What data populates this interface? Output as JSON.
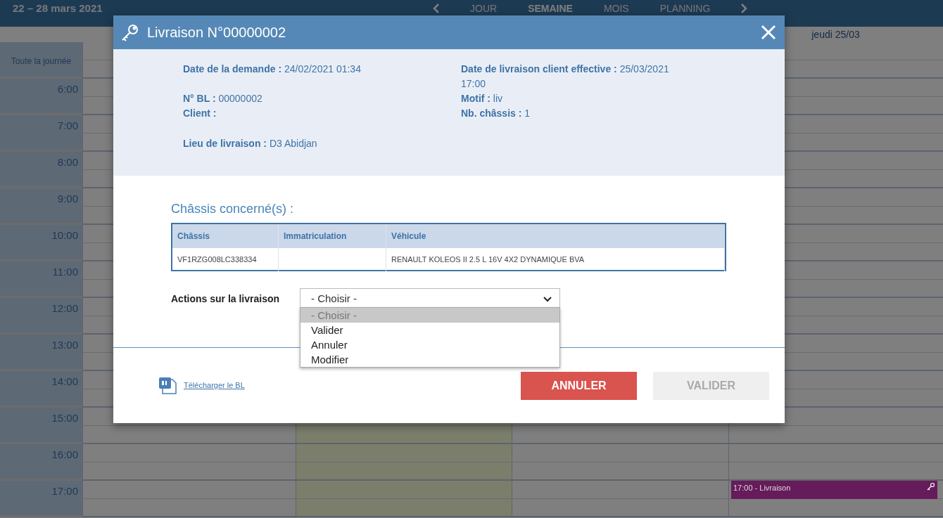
{
  "calendar": {
    "range": "22 – 28 mars 2021",
    "views": [
      {
        "label": "JOUR",
        "selected": false
      },
      {
        "label": "SEMAINE",
        "selected": true
      },
      {
        "label": "MOIS",
        "selected": false
      },
      {
        "label": "PLANNING",
        "selected": false
      }
    ],
    "day_header": "jeudi 25/03",
    "all_day_label": "Toute la journée",
    "hours": [
      "6:00",
      "7:00",
      "8:00",
      "9:00",
      "10:00",
      "11:00",
      "12:00",
      "13:00",
      "14:00",
      "15:00",
      "16:00",
      "17:00"
    ],
    "events": [
      {
        "label": "17:00 - Livraison",
        "color": "#661b5a"
      }
    ]
  },
  "modal": {
    "title": "Livraison N°00000002",
    "details_left": [
      {
        "label": "Date de la demande :",
        "value": "24/02/2021 01:34"
      },
      {
        "label": "N° BL :",
        "value": "00000002"
      },
      {
        "label": "Client :"
      },
      {
        "label": "Lieu de livraison :",
        "value": "D3 Abidjan"
      }
    ],
    "details_right": [
      {
        "label": "Date de livraison client effective :",
        "value": "25/03/2021 17:00"
      },
      {
        "label": "Motif :",
        "value": "liv"
      },
      {
        "label": "Nb. châssis :",
        "value": "1"
      }
    ],
    "section_title": "Châssis concerné(s) :",
    "table": {
      "columns": [
        "Châssis",
        "Immatriculation",
        "Véhicule"
      ],
      "rows": [
        [
          "VF1RZG008LC338334",
          "",
          "RENAULT KOLEOS II 2.5 L 16V 4X2 DYNAMIQUE BVA"
        ]
      ]
    },
    "actions": {
      "label": "Actions sur la livraison",
      "value": "- Choisir -",
      "expanded": true,
      "options": [
        {
          "label": "- Choisir -",
          "selected": true
        },
        {
          "label": "Valider",
          "selected": false
        },
        {
          "label": "Annuler",
          "selected": false
        },
        {
          "label": "Modifier",
          "selected": false
        }
      ]
    },
    "download_link": "Télécharger le BL",
    "buttons": [
      {
        "label": "ANNULER",
        "kind": "danger",
        "disabled": false
      },
      {
        "label": "VALIDER",
        "kind": "primary",
        "disabled": true
      }
    ]
  }
}
